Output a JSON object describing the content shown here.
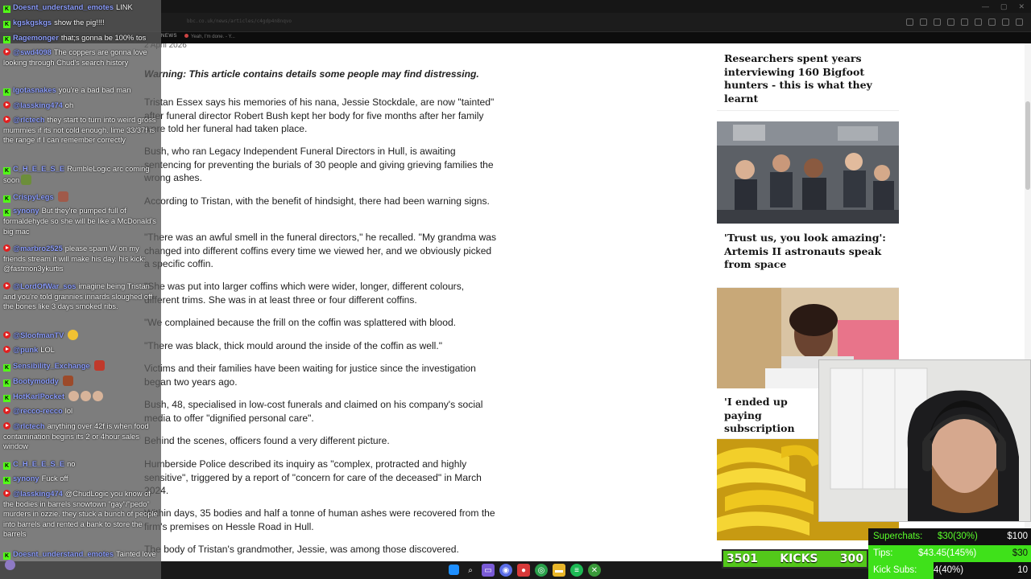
{
  "browser": {
    "url": "bbc.co.uk/news/articles/c4gdp4n8nqvo",
    "news_label": "NEWS",
    "clip_text": "Yeah, I'm done. - Y..."
  },
  "article": {
    "date": "2 April 2026",
    "warning": "Warning: This article contains details some people may find distressing.",
    "paragraphs": [
      "Tristan Essex says his memories of his nana, Jessie Stockdale, are now \"tainted\" after funeral director Robert Bush kept her body for five months after her family were told her funeral had taken place.",
      "Bush, who ran Legacy Independent Funeral Directors in Hull, is awaiting sentencing for preventing the burials of 30 people and giving grieving families the wrong ashes.",
      "According to Tristan, with the benefit of hindsight, there had been warning signs.",
      "\"There was an awful smell in the funeral directors,\" he recalled. \"My grandma was changed into different coffins every time we viewed her, and we obviously picked a specific coffin.",
      "\"She was put into larger coffins which were wider, longer, different colours, different trims. She was in at least three or four different coffins.",
      "\"We complained because the frill on the coffin was splattered with blood.",
      "\"There was black, thick mould around the inside of the coffin as well.\"",
      "Victims and their families have been waiting for justice since the investigation began two years ago.",
      "Bush, 48, specialised in low-cost funerals and claimed on his company's social media to offer \"dignified personal care\".",
      "Behind the scenes, officers found a very different picture.",
      "Humberside Police described its inquiry as \"complex, protracted and highly sensitive\", triggered by a report of \"concern for care of the deceased\" in March 2024.",
      "Within days, 35 bodies and half a tonne of human ashes were recovered from the firm's premises on Hessle Road in Hull.",
      "The body of Tristan's grandmother, Jessie, was among those discovered."
    ]
  },
  "sidebar": {
    "cards": [
      {
        "title": "Researchers spent years interviewing 160 Bigfoot hunters - this is what they learnt"
      },
      {
        "title": "'Trust us, you look amazing': Artemis II astronauts speak from space"
      },
      {
        "title": "'I ended up paying subscription trap"
      },
      {
        "title": ""
      }
    ]
  },
  "chat": [
    {
      "src": "kick",
      "user": "Doesnt_understand_emotes",
      "text": "LINK"
    },
    {
      "src": "kick",
      "user": "kgskgskgs",
      "text": "show the pig!!!!"
    },
    {
      "src": "kick",
      "user": "Ragemonger",
      "text": "that;s gonna be 100% tos"
    },
    {
      "src": "yt",
      "user": "@swd4098",
      "text": "The coppers are gonna love looking through Chud's search history"
    },
    {
      "src": "kick",
      "user": "lgotasnakes",
      "text": "you're a bad bad man"
    },
    {
      "src": "yt",
      "user": "@lassking474",
      "text": "oh"
    },
    {
      "src": "yt",
      "user": "@rlctech",
      "text": "they start to turn into weird gross mummies if its not cold enough. lime 33/37f is the range if I can remember correctly"
    },
    {
      "src": "kick",
      "user": "C_H_E_E_S_E",
      "text": "RumbleLogic arc coming soon"
    },
    {
      "src": "kick",
      "user": "CrispyLegs",
      "text": ""
    },
    {
      "src": "kick",
      "user": "synony",
      "text": "But they're pumped full of formaldehyde so she will be like a McDonald's big mac"
    },
    {
      "src": "yt",
      "user": "@marbro2525",
      "text": "please spam W on my friends stream it will make his day. his kick: @fastmon3ykurtis"
    },
    {
      "src": "yt",
      "user": "@LordOfWar_sos",
      "text": "imagine being Tristan and you're told grannies innards sloughed off the bones like 3 days smoked ribs."
    },
    {
      "src": "yt",
      "user": "@SloofmanTV",
      "text": ""
    },
    {
      "src": "yt",
      "user": "@punk",
      "text": "LOL"
    },
    {
      "src": "kick",
      "user": "Sensibility_Exchange",
      "text": ""
    },
    {
      "src": "kick",
      "user": "Bootymoddy",
      "text": ""
    },
    {
      "src": "kick",
      "user": "HotKarlPocket",
      "text": ""
    },
    {
      "src": "yt",
      "user": "@recco-recco",
      "text": "lol"
    },
    {
      "src": "yt",
      "user": "@rlctech",
      "text": "anything over 42f is when food contamination begins its 2 or 4hour sales window"
    },
    {
      "src": "kick",
      "user": "C_H_E_E_S_E",
      "text": "no"
    },
    {
      "src": "kick",
      "user": "synony",
      "text": "Fuck off"
    },
    {
      "src": "yt",
      "user": "@lassking474",
      "text": "@ChudLogic you know of the bodies in barrels snowtown \"gay\"/\"pedo\" murders in ozzie. they stuck a bunch of people into barrels and rented a bank to store the barrels"
    },
    {
      "src": "kick",
      "user": "Doesnt_understand_emotes",
      "text": "Tainted love"
    }
  ],
  "kicks": {
    "left": "3501",
    "label": "KICKS",
    "right": "300"
  },
  "stats": [
    {
      "label": "Superchats:",
      "mid": "$30(30%)",
      "right": "$100"
    },
    {
      "label": "Tips:",
      "mid": "$43.45(145%)",
      "right": "$30"
    },
    {
      "label": "Kick Subs:",
      "mid": "4(40%)",
      "right": "10"
    }
  ],
  "colors": {
    "kick_green": "#53fc18",
    "chat_user": "#8fa0ff",
    "stat_bar": "#3fe11a"
  },
  "taskbar": {
    "icons": [
      "windows-icon",
      "search-icon",
      "task-view-icon",
      "discord-icon",
      "obs-icon",
      "chrome-icon",
      "folder-icon",
      "spotify-icon",
      "xbox-icon"
    ]
  }
}
